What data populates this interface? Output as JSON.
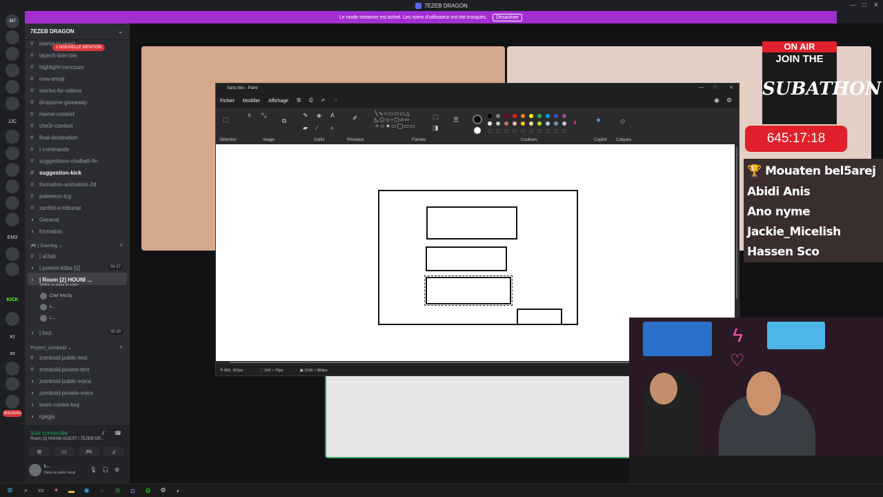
{
  "window": {
    "title": "7EZEB DRAGON"
  },
  "streamer_banner": {
    "text": "Le mode streamer est activé. Les noms d'utilisateur ont été tronqués.",
    "button": "Désactiver"
  },
  "servers": [
    {
      "label": "387"
    },
    {
      "label": ""
    },
    {
      "label": ""
    },
    {
      "label": ""
    },
    {
      "label": ""
    },
    {
      "label": ""
    },
    {
      "label": "JJC"
    },
    {
      "label": ""
    },
    {
      "label": ""
    },
    {
      "label": ""
    },
    {
      "label": ""
    },
    {
      "label": ""
    },
    {
      "label": ""
    },
    {
      "label": "EM3"
    },
    {
      "label": ""
    },
    {
      "label": ""
    },
    {
      "label": "KICK"
    },
    {
      "label": ""
    },
    {
      "label": "Kt"
    },
    {
      "label": "as"
    },
    {
      "label": ""
    },
    {
      "label": ""
    },
    {
      "label": ""
    },
    {
      "label": "NOUVEAU"
    }
  ],
  "sidebar": {
    "server_name": "7EZEB DRAGON",
    "mention_badge": "1 NOUVELLE MENTION",
    "text_channels": [
      "meme-to-react",
      "tayech-bien-bie",
      "highlight-concours",
      "new-emoji",
      "stories-for-videos",
      "dropzone-giveaway",
      "meme-contest",
      "che3r-contest",
      "final-destination",
      "| commands",
      "suggestions-chalba9-fm",
      "suggestion-kick",
      "formation-animation-2d",
      "pokemon-tcg",
      "zan9et-e-tribunal",
      "General",
      "formation"
    ],
    "gaming_category": "| Gaming",
    "gaming_channels": [
      "| al3ab",
      "| poeme ktiba [1]",
      "| Room [2] HOUNI ...",
      "| foot"
    ],
    "poeme_count": "00 27",
    "foot_count": "00 20",
    "room_status": "Définir un statut de salon",
    "voice_users": [
      "Chef Werzly",
      "k...",
      "L..."
    ],
    "project_category": "Porject_zomboid",
    "project_channels": [
      "zomboid-public-text",
      "zomboid-private-text",
      "zomboid-public-voice",
      "zomboid-private-voice",
      "team-contre-louj",
      "rgagja"
    ]
  },
  "voice_panel": {
    "status": "Voix connectée",
    "room": "Room [2] HOUNI GUEST / 7EZEB DR..."
  },
  "user_panel": {
    "name": "L...",
    "status": "Dans un salon vocal"
  },
  "paint": {
    "title": "Sans titre - Paint",
    "menu": [
      "Fichier",
      "Modifier",
      "Affichage"
    ],
    "groups": [
      "Sélection",
      "Image",
      "Outils",
      "Pinceaux",
      "Formes",
      "Couleurs",
      "Copilot",
      "Calques"
    ],
    "status": {
      "cursor": "860, 393px",
      "selection": "243 × 76px",
      "canvas": "1536 × 864px"
    }
  },
  "overlay": {
    "on_air": "ON AIR",
    "join": "JOIN THE",
    "subathon": "SUBATHON",
    "timer": "645:17:18",
    "names": [
      "Mouaten bel5arej",
      "Abidi Anis",
      "Ano nyme",
      "Jackie_Micelish",
      "Hassen Sco"
    ]
  },
  "colors": {
    "accent": "#a42fd0",
    "red": "#e0202a",
    "discord_bg": "#2b2d31"
  }
}
